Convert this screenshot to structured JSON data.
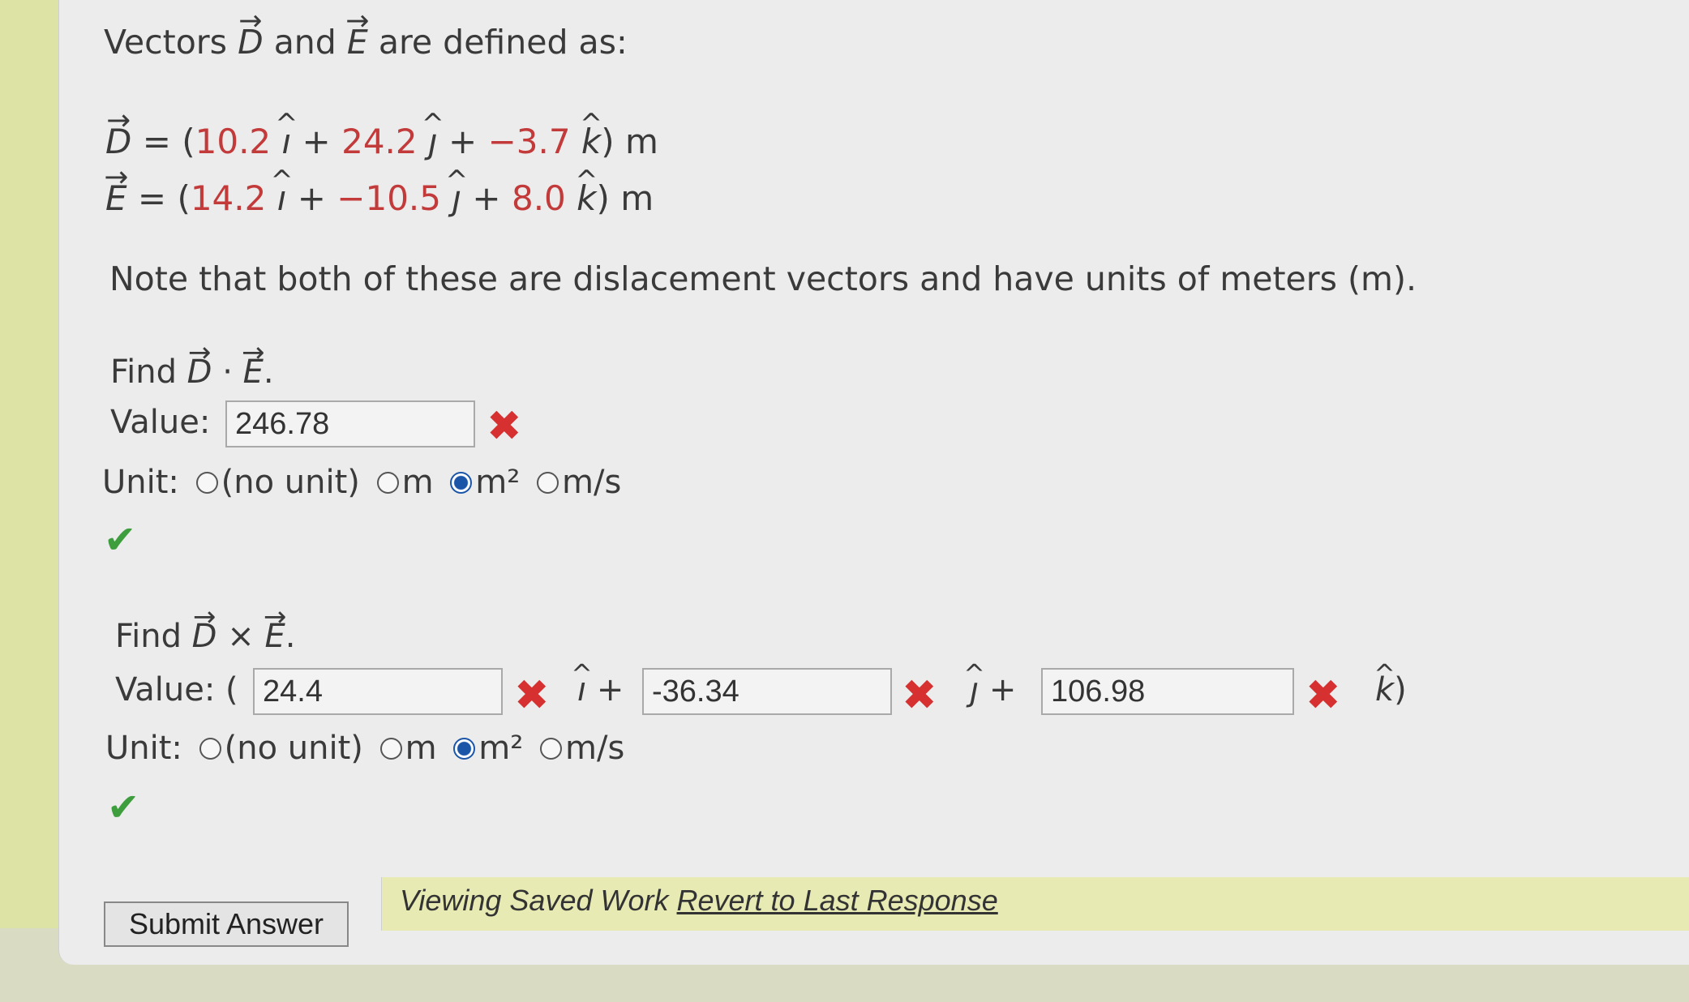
{
  "intro": {
    "prefix": "Vectors",
    "vec1": "D",
    "mid": "and",
    "vec2": "E",
    "suffix": "are defined as:"
  },
  "vectors": {
    "D": {
      "name": "D",
      "i": "10.2",
      "j": "24.2",
      "k": "−3.7",
      "unit": "m"
    },
    "E": {
      "name": "E",
      "i": "14.2",
      "j": "−10.5",
      "k": "8.0",
      "unit": "m"
    }
  },
  "note": "Note that both of these are dislacement vectors and have units of meters (m).",
  "q1": {
    "find_prefix": "Find",
    "op": "·",
    "value_label": "Value:",
    "value": "246.78",
    "unit_label": "Unit:",
    "unit_options": [
      "(no unit)",
      "m",
      "m²",
      "m/s"
    ],
    "selected_unit": "m²"
  },
  "q2": {
    "find_prefix": "Find",
    "op": "×",
    "value_label": "Value: (",
    "i_value": "24.4",
    "j_value": "-36.34",
    "k_value": "106.98",
    "unit_label": "Unit:",
    "unit_options": [
      "(no unit)",
      "m",
      "m²",
      "m/s"
    ],
    "selected_unit": "m²"
  },
  "symbols": {
    "i": "ı",
    "j": "ȷ",
    "k": "k",
    "plus": "+",
    "close": ")",
    "period": "."
  },
  "banner": {
    "text": "Viewing Saved Work",
    "link": "Revert to Last Response"
  },
  "submit_label": "Submit Answer",
  "colors": {
    "value_red": "#c33a3a",
    "wrong_mark": "#d63030",
    "correct_mark": "#3e9e3e",
    "radio_selected": "#1a55a8",
    "banner_bg": "#e8eab4"
  }
}
